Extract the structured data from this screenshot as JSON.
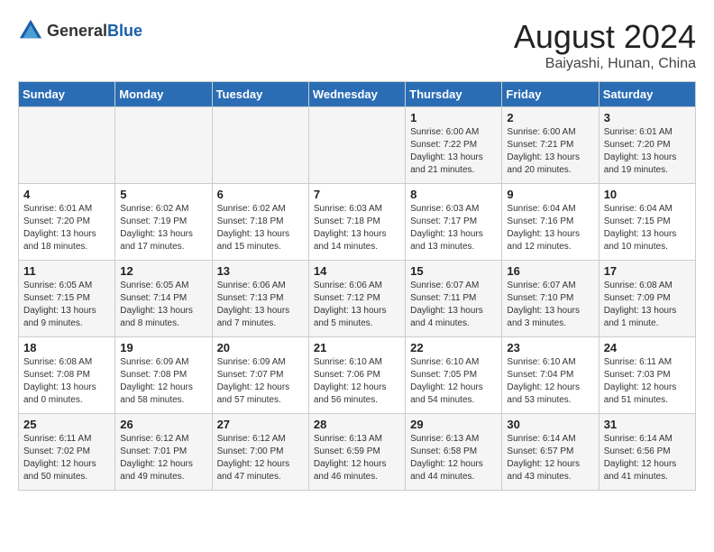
{
  "logo": {
    "general": "General",
    "blue": "Blue"
  },
  "header": {
    "month": "August 2024",
    "location": "Baiyashi, Hunan, China"
  },
  "days_of_week": [
    "Sunday",
    "Monday",
    "Tuesday",
    "Wednesday",
    "Thursday",
    "Friday",
    "Saturday"
  ],
  "weeks": [
    [
      {
        "day": "",
        "info": ""
      },
      {
        "day": "",
        "info": ""
      },
      {
        "day": "",
        "info": ""
      },
      {
        "day": "",
        "info": ""
      },
      {
        "day": "1",
        "info": "Sunrise: 6:00 AM\nSunset: 7:22 PM\nDaylight: 13 hours\nand 21 minutes."
      },
      {
        "day": "2",
        "info": "Sunrise: 6:00 AM\nSunset: 7:21 PM\nDaylight: 13 hours\nand 20 minutes."
      },
      {
        "day": "3",
        "info": "Sunrise: 6:01 AM\nSunset: 7:20 PM\nDaylight: 13 hours\nand 19 minutes."
      }
    ],
    [
      {
        "day": "4",
        "info": "Sunrise: 6:01 AM\nSunset: 7:20 PM\nDaylight: 13 hours\nand 18 minutes."
      },
      {
        "day": "5",
        "info": "Sunrise: 6:02 AM\nSunset: 7:19 PM\nDaylight: 13 hours\nand 17 minutes."
      },
      {
        "day": "6",
        "info": "Sunrise: 6:02 AM\nSunset: 7:18 PM\nDaylight: 13 hours\nand 15 minutes."
      },
      {
        "day": "7",
        "info": "Sunrise: 6:03 AM\nSunset: 7:18 PM\nDaylight: 13 hours\nand 14 minutes."
      },
      {
        "day": "8",
        "info": "Sunrise: 6:03 AM\nSunset: 7:17 PM\nDaylight: 13 hours\nand 13 minutes."
      },
      {
        "day": "9",
        "info": "Sunrise: 6:04 AM\nSunset: 7:16 PM\nDaylight: 13 hours\nand 12 minutes."
      },
      {
        "day": "10",
        "info": "Sunrise: 6:04 AM\nSunset: 7:15 PM\nDaylight: 13 hours\nand 10 minutes."
      }
    ],
    [
      {
        "day": "11",
        "info": "Sunrise: 6:05 AM\nSunset: 7:15 PM\nDaylight: 13 hours\nand 9 minutes."
      },
      {
        "day": "12",
        "info": "Sunrise: 6:05 AM\nSunset: 7:14 PM\nDaylight: 13 hours\nand 8 minutes."
      },
      {
        "day": "13",
        "info": "Sunrise: 6:06 AM\nSunset: 7:13 PM\nDaylight: 13 hours\nand 7 minutes."
      },
      {
        "day": "14",
        "info": "Sunrise: 6:06 AM\nSunset: 7:12 PM\nDaylight: 13 hours\nand 5 minutes."
      },
      {
        "day": "15",
        "info": "Sunrise: 6:07 AM\nSunset: 7:11 PM\nDaylight: 13 hours\nand 4 minutes."
      },
      {
        "day": "16",
        "info": "Sunrise: 6:07 AM\nSunset: 7:10 PM\nDaylight: 13 hours\nand 3 minutes."
      },
      {
        "day": "17",
        "info": "Sunrise: 6:08 AM\nSunset: 7:09 PM\nDaylight: 13 hours\nand 1 minute."
      }
    ],
    [
      {
        "day": "18",
        "info": "Sunrise: 6:08 AM\nSunset: 7:08 PM\nDaylight: 13 hours\nand 0 minutes."
      },
      {
        "day": "19",
        "info": "Sunrise: 6:09 AM\nSunset: 7:08 PM\nDaylight: 12 hours\nand 58 minutes."
      },
      {
        "day": "20",
        "info": "Sunrise: 6:09 AM\nSunset: 7:07 PM\nDaylight: 12 hours\nand 57 minutes."
      },
      {
        "day": "21",
        "info": "Sunrise: 6:10 AM\nSunset: 7:06 PM\nDaylight: 12 hours\nand 56 minutes."
      },
      {
        "day": "22",
        "info": "Sunrise: 6:10 AM\nSunset: 7:05 PM\nDaylight: 12 hours\nand 54 minutes."
      },
      {
        "day": "23",
        "info": "Sunrise: 6:10 AM\nSunset: 7:04 PM\nDaylight: 12 hours\nand 53 minutes."
      },
      {
        "day": "24",
        "info": "Sunrise: 6:11 AM\nSunset: 7:03 PM\nDaylight: 12 hours\nand 51 minutes."
      }
    ],
    [
      {
        "day": "25",
        "info": "Sunrise: 6:11 AM\nSunset: 7:02 PM\nDaylight: 12 hours\nand 50 minutes."
      },
      {
        "day": "26",
        "info": "Sunrise: 6:12 AM\nSunset: 7:01 PM\nDaylight: 12 hours\nand 49 minutes."
      },
      {
        "day": "27",
        "info": "Sunrise: 6:12 AM\nSunset: 7:00 PM\nDaylight: 12 hours\nand 47 minutes."
      },
      {
        "day": "28",
        "info": "Sunrise: 6:13 AM\nSunset: 6:59 PM\nDaylight: 12 hours\nand 46 minutes."
      },
      {
        "day": "29",
        "info": "Sunrise: 6:13 AM\nSunset: 6:58 PM\nDaylight: 12 hours\nand 44 minutes."
      },
      {
        "day": "30",
        "info": "Sunrise: 6:14 AM\nSunset: 6:57 PM\nDaylight: 12 hours\nand 43 minutes."
      },
      {
        "day": "31",
        "info": "Sunrise: 6:14 AM\nSunset: 6:56 PM\nDaylight: 12 hours\nand 41 minutes."
      }
    ]
  ]
}
